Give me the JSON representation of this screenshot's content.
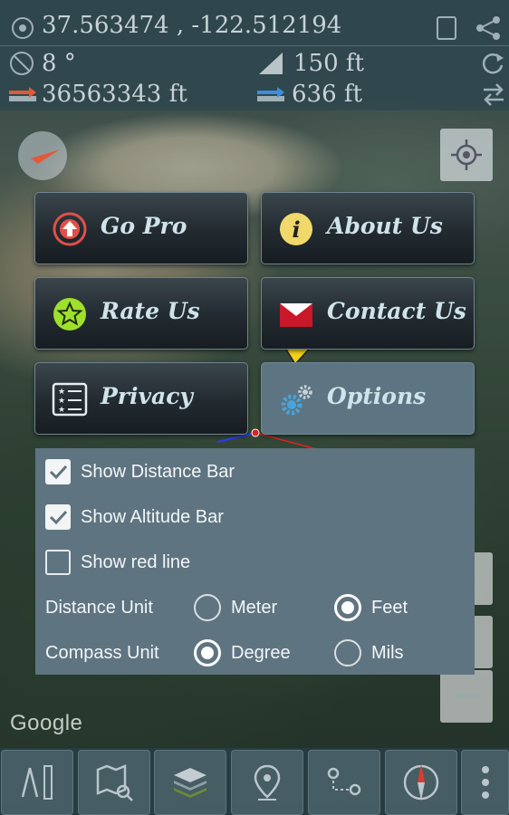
{
  "info": {
    "coordinates": "37.563474 , -122.512194",
    "angle": "8 °",
    "altitude": "150 ft",
    "distance_total": "36563343 ft",
    "distance_segment": "636 ft"
  },
  "menu": {
    "go_pro": "Go Pro",
    "about_us": "About Us",
    "rate_us": "Rate Us",
    "contact_us": "Contact Us",
    "privacy": "Privacy",
    "options": "Options"
  },
  "options_panel": {
    "show_distance_bar": {
      "label": "Show Distance Bar",
      "checked": true
    },
    "show_altitude_bar": {
      "label": "Show Altitude Bar",
      "checked": true
    },
    "show_red_line": {
      "label": "Show red line",
      "checked": false
    },
    "distance_unit": {
      "label": "Distance Unit",
      "options": [
        "Meter",
        "Feet"
      ],
      "selected": "Feet"
    },
    "compass_unit": {
      "label": "Compass Unit",
      "options": [
        "Degree",
        "Mils"
      ],
      "selected": "Degree"
    }
  },
  "map": {
    "attribution": "Google"
  },
  "toolbar": {
    "icons": [
      "ruler-compass-icon",
      "map-search-icon",
      "layers-icon",
      "location-pin-icon",
      "route-icon",
      "compass-icon",
      "more-vert-icon"
    ]
  },
  "colors": {
    "accent_red": "#e03a2c",
    "panel_bg": "#5f7481",
    "button_text": "#cfe3ea"
  }
}
